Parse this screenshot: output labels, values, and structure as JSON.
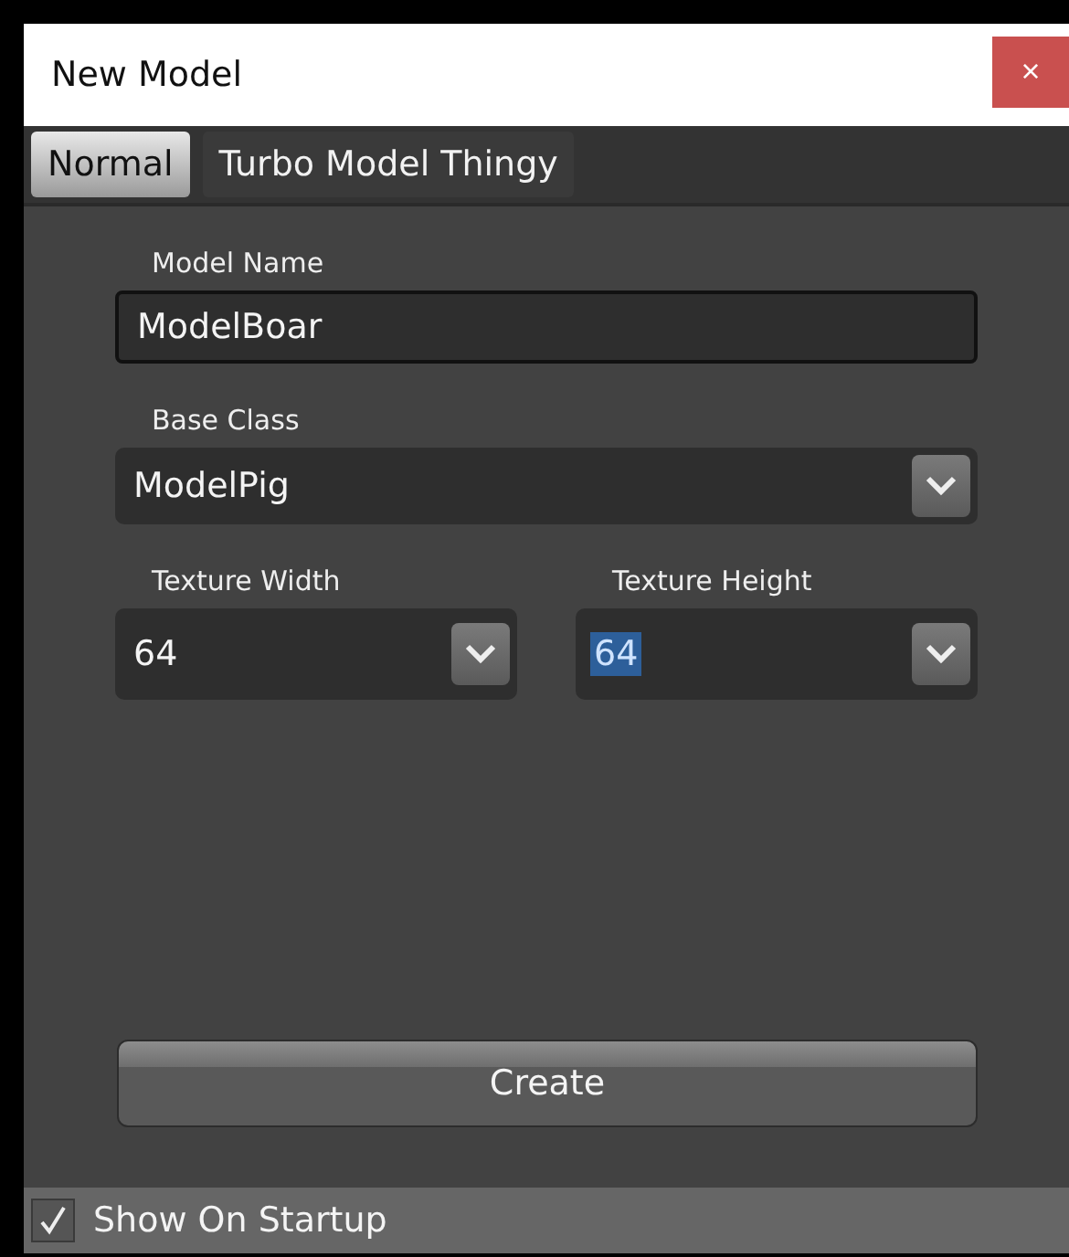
{
  "window": {
    "title": "New Model",
    "close": "×"
  },
  "tabs": [
    {
      "label": "Normal",
      "selected": true
    },
    {
      "label": "Turbo Model Thingy",
      "selected": false
    }
  ],
  "fields": [
    [
      {
        "kind": "text",
        "label": "Model Name",
        "value": "ModelBoar",
        "text_selected": false
      }
    ],
    [
      {
        "kind": "dropdown",
        "label": "Base Class",
        "value": "ModelPig",
        "text_selected": false
      }
    ],
    [
      {
        "kind": "dropdown",
        "label": "Texture Width",
        "value": "64",
        "text_selected": false
      },
      {
        "kind": "dropdown",
        "label": "Texture Height",
        "value": "64",
        "text_selected": true
      }
    ]
  ],
  "create_button": "Create",
  "footer": {
    "label": "Show On Startup",
    "checked": true
  }
}
